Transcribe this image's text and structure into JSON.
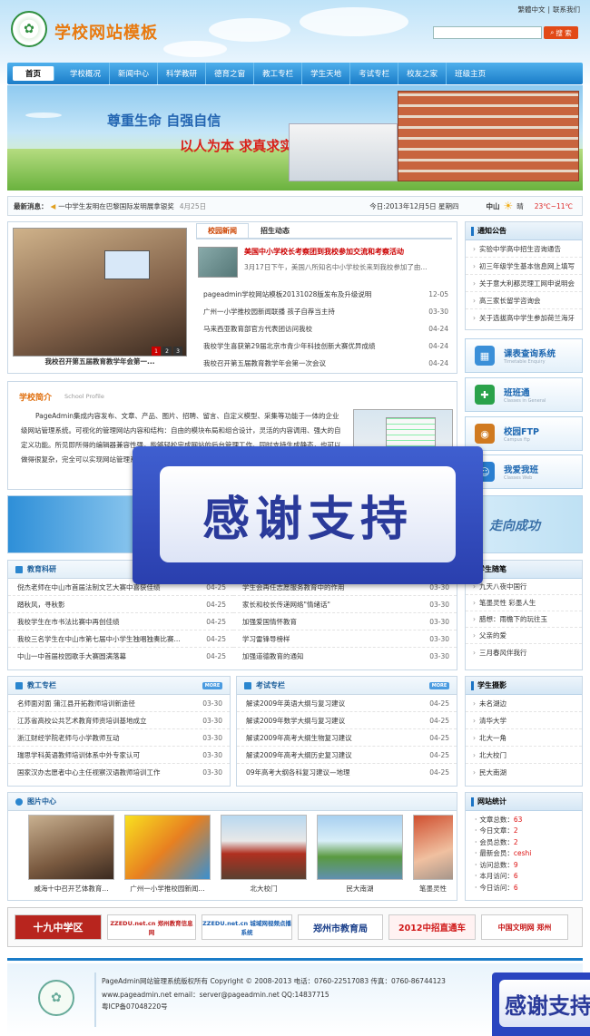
{
  "header": {
    "site_title": "学校网站模板",
    "lang_link": "繁體中文",
    "contact_link": "联系我们",
    "search_button": "搜 索",
    "search_placeholder": ""
  },
  "nav": {
    "items": [
      "首页",
      "学校概况",
      "新闻中心",
      "科学教研",
      "德育之窗",
      "教工专栏",
      "学生天地",
      "考试专栏",
      "校友之家",
      "班级主页"
    ]
  },
  "banner": {
    "slogan_line1": "尊重生命  自强自信",
    "slogan_line2": "以人为本  求真求实"
  },
  "news_ticker": {
    "label": "最新消息：",
    "text": "一中学生发明在巴黎国际发明展拿银奖",
    "date": "4月25日",
    "today": "今日:2013年12月5日 星期四",
    "city": "中山",
    "weather": "晴",
    "temp": "23℃~11℃"
  },
  "slideshow": {
    "caption": "我校召开第五届教育教学年会第一...",
    "pages": [
      "1",
      "2",
      "3"
    ]
  },
  "campus_news": {
    "tabs": [
      "校园新闻",
      "招生动态"
    ],
    "headline": "美国中小学校长考察团到我校参加交流和考察活动",
    "summary": "3月17日下午，美国八所知名中小学校长来到我校参加了由...",
    "items": [
      {
        "t": "pageadmin学校网站模板20131028版发布及升级说明",
        "d": "12-05"
      },
      {
        "t": "广州一小学推校园新闻联播 孩子自荐当主持",
        "d": "03-30"
      },
      {
        "t": "马来西亚教育部官方代表团访问我校",
        "d": "04-24"
      },
      {
        "t": "我校学生喜获第29届北京市青少年科技创新大赛优异成绩",
        "d": "04-24"
      },
      {
        "t": "我校召开第五届教育教学年会第一次会议",
        "d": "04-24"
      }
    ]
  },
  "notice": {
    "title": "通知公告",
    "items": [
      "实验中学高中招生咨询通告",
      "初三年级学生基本信息网上填写",
      "关于意大利都灵理工网申说明会",
      "高三家长留学咨询会",
      "关于选拔高中学生参加荷兰海牙"
    ]
  },
  "quick_links": [
    {
      "title": "课表查询系统",
      "sub": "Timetable Enquiry",
      "icon": "calendar-icon",
      "color": "#3a8fd8"
    },
    {
      "title": "班班通",
      "sub": "Classes in General",
      "icon": "puzzle-icon",
      "color": "#2aa24a"
    },
    {
      "title": "校园FTP",
      "sub": "Campus ftp",
      "icon": "globe-icon",
      "color": "#d07a20"
    },
    {
      "title": "我爱我班",
      "sub": "Classes Web",
      "icon": "people-icon",
      "color": "#2a7fd0"
    }
  ],
  "profile": {
    "title": "学校简介",
    "subtitle": "School Profile",
    "text": "PageAdmin集成内容发布、文章、产品、图片、招聘、留言、自定义模型、采集等功能于一体的企业级网站管理系统。可视化的管理网站内容和结构：自由的模块布局和组合设计，灵活的内容调用、强大的自定义功能。所见即所得的编辑器兼容性强，能够轻松完成网站的后台管理工作。同时支持生成静态，也可以做得很复杂，完全可以实现网站管理系统的所有功能，机构，遵循国际最新W3C网页设计标准"
  },
  "overlay": {
    "text": "感谢支持"
  },
  "overlay_small": {
    "text": "感谢支持"
  },
  "middle_banner": {
    "text": "走向成功"
  },
  "research": {
    "title": "教育科研",
    "items": [
      {
        "t": "倪杰老师在中山市首届法制文艺大赛中喜获佳绩",
        "d": "04-25"
      },
      {
        "t": "踏秋风，寻秋影",
        "d": "04-25"
      },
      {
        "t": "我校学生在市书法比赛中再创佳绩",
        "d": "04-25"
      },
      {
        "t": "我校三名学生在中山市第七届中小学生独唱独奏比赛...",
        "d": "04-25"
      },
      {
        "t": "中山一中首届校园歌手大赛圆满落幕",
        "d": "04-25"
      }
    ]
  },
  "research2": {
    "items": [
      {
        "t": "学生会再任志愿服务教育中的作用",
        "d": "03-30"
      },
      {
        "t": "家长和校长传递网络\"情绪话\"",
        "d": "03-30"
      },
      {
        "t": "加强爱国情怀教育",
        "d": "03-30"
      },
      {
        "t": "学习雷锋导榜样",
        "d": "03-30"
      },
      {
        "t": "加强道德教育的通知",
        "d": "03-30"
      }
    ]
  },
  "teachers": {
    "title": "教工专栏",
    "items": [
      {
        "t": "名师面对面 蒲江县开拓教师培训新途径",
        "d": "03-30"
      },
      {
        "t": "江苏省高校公共艺术教育师资培训基地成立",
        "d": "03-30"
      },
      {
        "t": "浙江财经学院老师与小学教师互动",
        "d": "03-30"
      },
      {
        "t": "瑞思学科英语教师培训体系中外专家认可",
        "d": "03-30"
      },
      {
        "t": "国家汉办志愿者中心主任视察汉语教师培训工作",
        "d": "03-30"
      }
    ]
  },
  "exams": {
    "title": "考试专栏",
    "items": [
      {
        "t": "解读2009年英语大纲与复习建议",
        "d": "04-25"
      },
      {
        "t": "解读2009年数学大纲与复习建议",
        "d": "04-25"
      },
      {
        "t": "解读2009年高考大纲生物复习建议",
        "d": "04-25"
      },
      {
        "t": "解读2009年高考大纲历史复习建议",
        "d": "04-25"
      },
      {
        "t": "09年高考大纲各科复习建议—地理",
        "d": "04-25"
      }
    ]
  },
  "essays": {
    "title": "学生随笔",
    "items": [
      "九天八夜中国行",
      "笔墨灵性 彩墨人生",
      "腊想：雨檐下的玩往玉",
      "父亲的爱",
      "三月春风伴我行"
    ]
  },
  "photography": {
    "title": "学生摄影",
    "items": [
      "未名湖边",
      "清华大学",
      "北大一角",
      "北大校门",
      "民大南湖"
    ]
  },
  "gallery": {
    "title": "图片中心",
    "items": [
      "威海十中召开艺体教育...",
      "广州一小学推校园新闻...",
      "北大校门",
      "民大南湖",
      "笔墨灵性"
    ]
  },
  "stats": {
    "title": "网站统计",
    "items": [
      {
        "k": "文章总数：",
        "v": "63"
      },
      {
        "k": "今日文章：",
        "v": "2"
      },
      {
        "k": "会员总数：",
        "v": "2"
      },
      {
        "k": "最新会员：",
        "v": "ceshi"
      },
      {
        "k": "访问总数：",
        "v": "9"
      },
      {
        "k": "本月访问：",
        "v": "6"
      },
      {
        "k": "今日访问：",
        "v": "6"
      }
    ]
  },
  "partners": [
    {
      "text": "十九中学区",
      "color": "#fff",
      "bg": "#b8251e"
    },
    {
      "text": "ZZEDU.net.cn 郑州教育信息网",
      "color": "#c02020",
      "bg": "#ffffff"
    },
    {
      "text": "ZZEDU.net.cn 城域网视频点播系统",
      "color": "#1a5fb0",
      "bg": "#ffffff"
    },
    {
      "text": "郑州市教育局",
      "color": "#1a3f8a",
      "bg": "#ffffff"
    },
    {
      "text": "2012中招直通车",
      "color": "#d01818",
      "bg": "#fff2f2"
    },
    {
      "text": "中国文明网 郑州",
      "color": "#c81818",
      "bg": "#ffffff"
    }
  ],
  "footer": {
    "line1": "PageAdmin网站管理系统版权所有 Copyright © 2008-2013    电话：0760-22517083  传真：0760-86744123",
    "line2": "www.pageadmin.net  email：server@pageadmin.net  QQ:14837715",
    "line3": "粤ICP备07048220号"
  }
}
